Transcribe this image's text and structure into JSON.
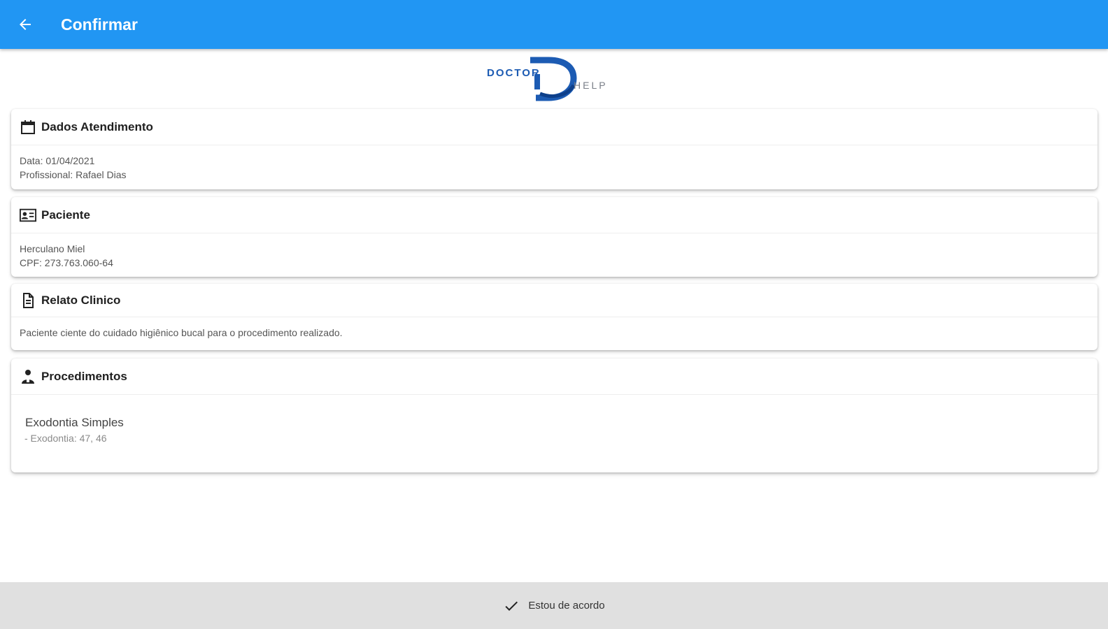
{
  "header": {
    "title": "Confirmar",
    "back_icon": "arrow-left-icon"
  },
  "logo": {
    "word1": "DOCTOR",
    "word2": "HELP",
    "colors": {
      "primary": "#1c5bb3",
      "secondary": "#7a7f88"
    }
  },
  "cards": {
    "dados": {
      "title": "Dados Atendimento",
      "icon": "calendar-icon",
      "data": "Data: 01/04/2021",
      "profissional": "Profissional: Rafael Dias"
    },
    "paciente": {
      "title": "Paciente",
      "icon": "id-card-icon",
      "nome": "Herculano Miel",
      "cpf": "CPF: 273.763.060-64"
    },
    "relato": {
      "title": "Relato Clinico",
      "icon": "document-icon",
      "texto": "Paciente ciente do cuidado higiênico bucal para o procedimento realizado."
    },
    "procedimentos": {
      "title": "Procedimentos",
      "icon": "doctor-icon",
      "items": [
        {
          "name": "Exodontia Simples",
          "detail": "- Exodontia: 47, 46"
        }
      ]
    }
  },
  "footer": {
    "label": "Estou de acordo",
    "icon": "check-icon"
  },
  "colors": {
    "appbar": "#2196f3",
    "footer": "#e0e0e0"
  }
}
